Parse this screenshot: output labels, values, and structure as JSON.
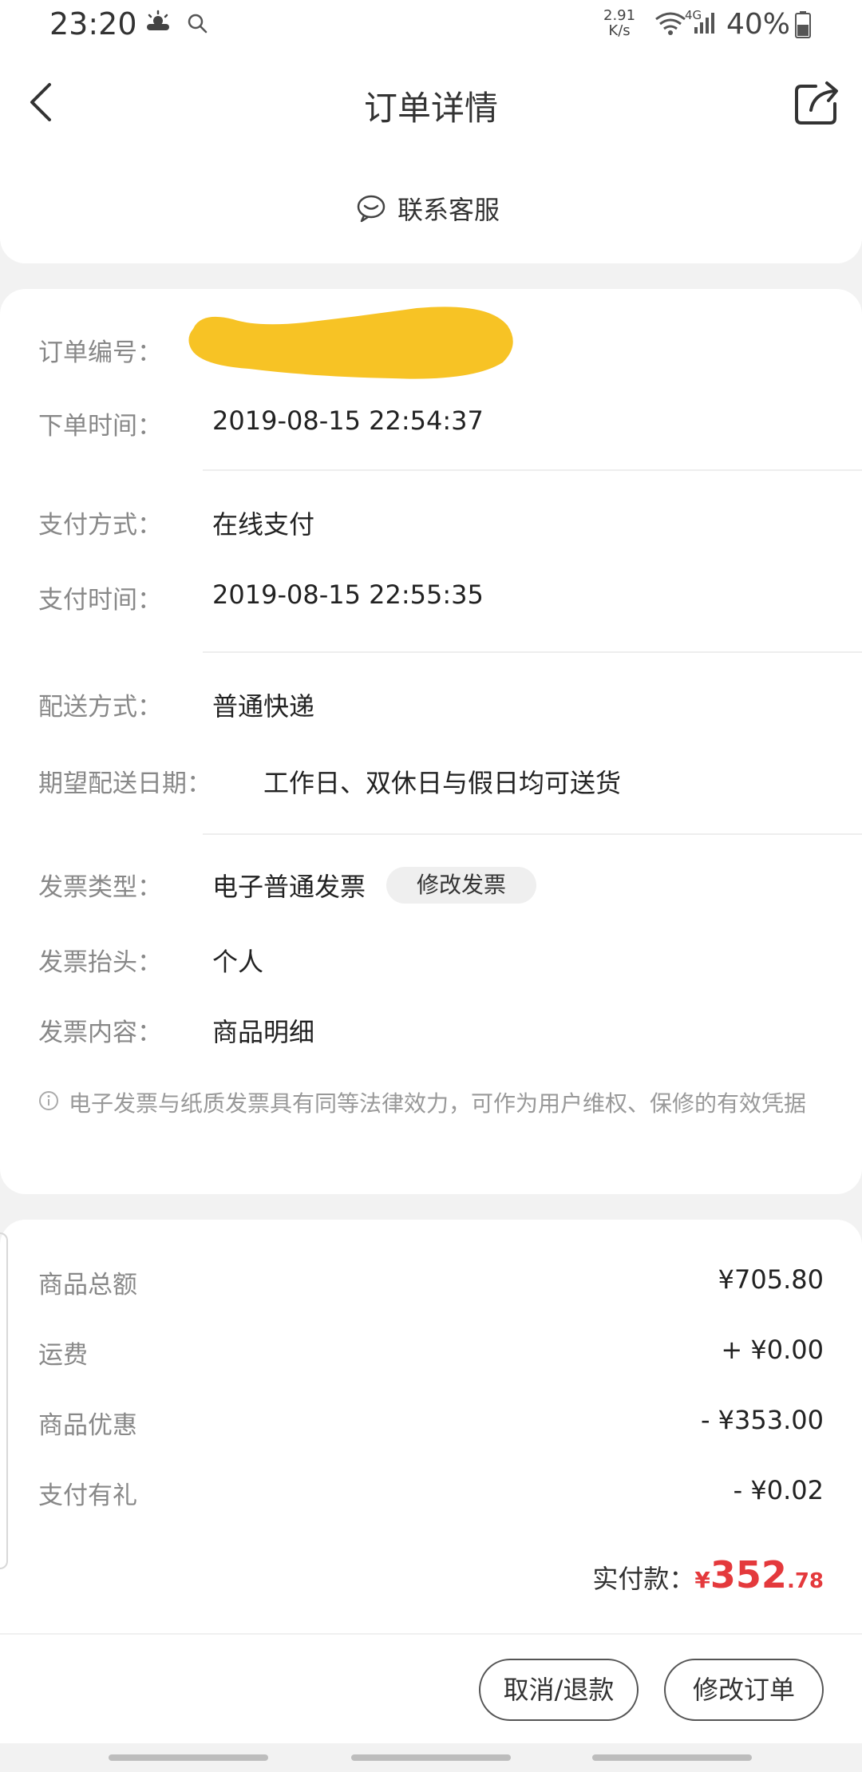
{
  "status_bar": {
    "time": "23:20",
    "net_speed": "2.91\nK/s",
    "net_speed_top": "2.91",
    "net_speed_bottom": "K/s",
    "network_type": "4G",
    "battery": "40%",
    "icons": [
      "weather-cloudy-sun-icon",
      "search-icon",
      "wifi-icon",
      "signal-icon",
      "battery-icon"
    ]
  },
  "nav": {
    "title": "订单详情",
    "back_icon": "chevron-left-icon",
    "share_icon": "share-icon"
  },
  "contact": {
    "label": "联系客服",
    "icon": "chat-bubble-icon"
  },
  "order_info": {
    "order_no_label": "订单编号：",
    "order_time_label": "下单时间：",
    "order_time": "2019-08-15 22:54:37",
    "pay_method_label": "支付方式：",
    "pay_method": "在线支付",
    "pay_time_label": "支付时间：",
    "pay_time": "2019-08-15 22:55:35",
    "delivery_method_label": "配送方式：",
    "delivery_method": "普通快递",
    "expected_date_label": "期望配送日期：",
    "expected_date": "工作日、双休日与假日均可送货",
    "invoice_type_label": "发票类型：",
    "invoice_type": "电子普通发票",
    "edit_invoice": "修改发票",
    "invoice_title_label": "发票抬头：",
    "invoice_title": "个人",
    "invoice_content_label": "发票内容：",
    "invoice_content": "商品明细",
    "notice": "电子发票与纸质发票具有同等法律效力，可作为用户维权、保修的有效凭据"
  },
  "price": {
    "goods_total_label": "商品总额",
    "goods_total": "¥705.80",
    "shipping_label": "运费",
    "shipping": "+ ¥0.00",
    "discount_label": "商品优惠",
    "discount": "- ¥353.00",
    "pay_gift_label": "支付有礼",
    "pay_gift": "- ¥0.02",
    "paid_label": "实付款：",
    "paid_yen": "¥",
    "paid_int": "352",
    "paid_dec": ".78",
    "accent_color": "#e4393c"
  },
  "actions": {
    "cancel_refund": "取消/退款",
    "modify_order": "修改订单"
  }
}
